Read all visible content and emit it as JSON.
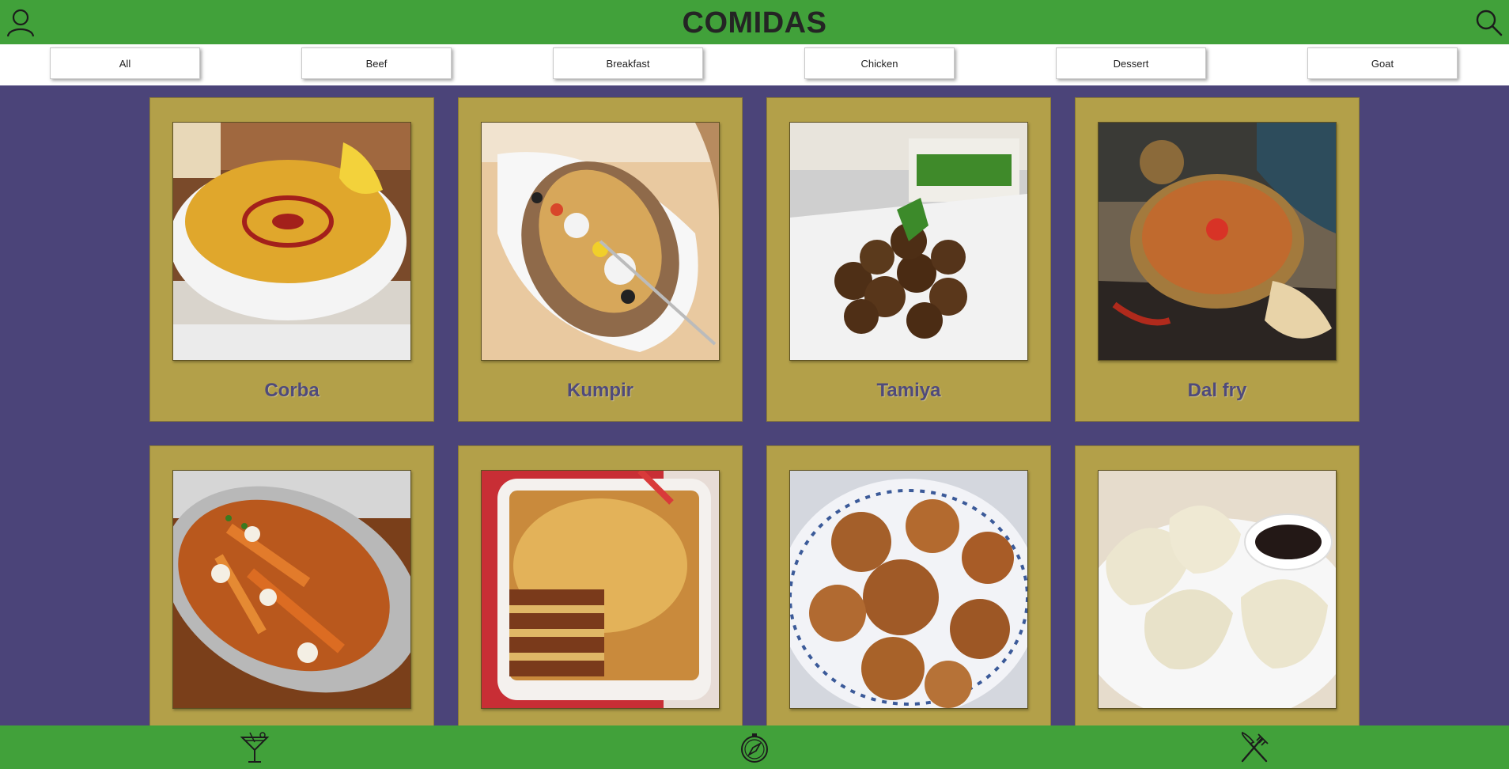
{
  "header": {
    "title": "COMIDAS",
    "profile_icon": "user-profile-icon",
    "search_icon": "search-icon"
  },
  "filters": [
    "All",
    "Beef",
    "Breakfast",
    "Chicken",
    "Dessert",
    "Goat"
  ],
  "meals": [
    {
      "name": "Corba",
      "image": "lentil-soup-bowl"
    },
    {
      "name": "Kumpir",
      "image": "stuffed-baked-potato"
    },
    {
      "name": "Tamiya",
      "image": "falafel-plate"
    },
    {
      "name": "Dal fry",
      "image": "dal-curry-bowl"
    },
    {
      "name": "",
      "image": "poutine-plate"
    },
    {
      "name": "",
      "image": "lasagna-dish"
    },
    {
      "name": "",
      "image": "sugar-doughnuts"
    },
    {
      "name": "",
      "image": "dumplings-with-sauce"
    }
  ],
  "footer": {
    "icons": [
      "cocktail-icon",
      "compass-icon",
      "fork-knife-icon"
    ]
  },
  "colors": {
    "header_bg": "#41a13a",
    "page_bg": "#4b4479",
    "card_bg": "#b3a049",
    "card_title": "#4f4a7b"
  }
}
